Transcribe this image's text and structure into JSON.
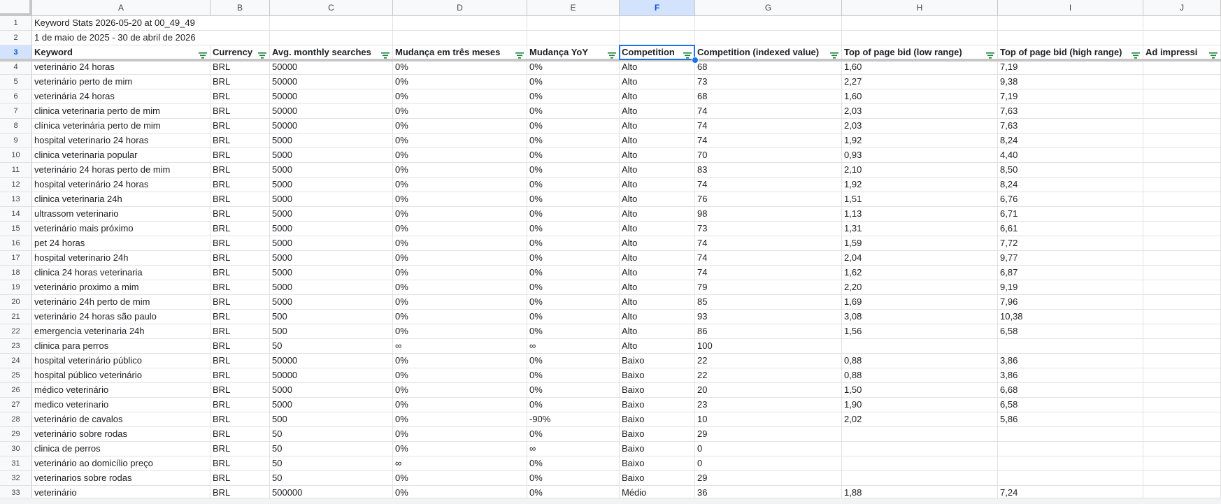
{
  "columns": [
    "A",
    "B",
    "C",
    "D",
    "E",
    "F",
    "G",
    "H",
    "I",
    "J"
  ],
  "active_column": "F",
  "active_row": 3,
  "rows": [
    {
      "num": "1",
      "cells": [
        "Keyword Stats 2026-05-20 at 00_49_49",
        "",
        "",
        "",
        "",
        "",
        "",
        "",
        "",
        ""
      ]
    },
    {
      "num": "2",
      "cells": [
        "1 de maio de 2025 - 30 de abril de 2026",
        "",
        "",
        "",
        "",
        "",
        "",
        "",
        "",
        ""
      ]
    },
    {
      "num": "3",
      "cells": [
        "Keyword",
        "Currency",
        "Avg. monthly searches",
        "Mudança em três meses",
        "Mudança YoY",
        "Competition",
        "Competition (indexed value)",
        "Top of page bid (low range)",
        "Top of page bid (high range)",
        "Ad impressi"
      ]
    },
    {
      "num": "4",
      "cells": [
        "veterinário 24 horas",
        "BRL",
        "50000",
        "0%",
        "0%",
        "Alto",
        "68",
        "1,60",
        "7,19",
        ""
      ]
    },
    {
      "num": "5",
      "cells": [
        "veterinário perto de mim",
        "BRL",
        "50000",
        "0%",
        "0%",
        "Alto",
        "73",
        "2,27",
        "9,38",
        ""
      ]
    },
    {
      "num": "6",
      "cells": [
        "veterinária 24 horas",
        "BRL",
        "50000",
        "0%",
        "0%",
        "Alto",
        "68",
        "1,60",
        "7,19",
        ""
      ]
    },
    {
      "num": "7",
      "cells": [
        "clinica veterinaria perto de mim",
        "BRL",
        "50000",
        "0%",
        "0%",
        "Alto",
        "74",
        "2,03",
        "7,63",
        ""
      ]
    },
    {
      "num": "8",
      "cells": [
        "clínica veterinária perto de mim",
        "BRL",
        "50000",
        "0%",
        "0%",
        "Alto",
        "74",
        "2,03",
        "7,63",
        ""
      ]
    },
    {
      "num": "9",
      "cells": [
        "hospital veterinario 24 horas",
        "BRL",
        "5000",
        "0%",
        "0%",
        "Alto",
        "74",
        "1,92",
        "8,24",
        ""
      ]
    },
    {
      "num": "10",
      "cells": [
        "clinica veterinaria popular",
        "BRL",
        "5000",
        "0%",
        "0%",
        "Alto",
        "70",
        "0,93",
        "4,40",
        ""
      ]
    },
    {
      "num": "11",
      "cells": [
        "veterinário 24 horas perto de mim",
        "BRL",
        "5000",
        "0%",
        "0%",
        "Alto",
        "83",
        "2,10",
        "8,50",
        ""
      ]
    },
    {
      "num": "12",
      "cells": [
        "hospital veterinário 24 horas",
        "BRL",
        "5000",
        "0%",
        "0%",
        "Alto",
        "74",
        "1,92",
        "8,24",
        ""
      ]
    },
    {
      "num": "13",
      "cells": [
        "clinica veterinaria 24h",
        "BRL",
        "5000",
        "0%",
        "0%",
        "Alto",
        "76",
        "1,51",
        "6,76",
        ""
      ]
    },
    {
      "num": "14",
      "cells": [
        "ultrassom veterinario",
        "BRL",
        "5000",
        "0%",
        "0%",
        "Alto",
        "98",
        "1,13",
        "6,71",
        ""
      ]
    },
    {
      "num": "15",
      "cells": [
        "veterinário mais próximo",
        "BRL",
        "5000",
        "0%",
        "0%",
        "Alto",
        "73",
        "1,31",
        "6,61",
        ""
      ]
    },
    {
      "num": "16",
      "cells": [
        "pet 24 horas",
        "BRL",
        "5000",
        "0%",
        "0%",
        "Alto",
        "74",
        "1,59",
        "7,72",
        ""
      ]
    },
    {
      "num": "17",
      "cells": [
        "hospital veterinario 24h",
        "BRL",
        "5000",
        "0%",
        "0%",
        "Alto",
        "74",
        "2,04",
        "9,77",
        ""
      ]
    },
    {
      "num": "18",
      "cells": [
        "clinica 24 horas veterinaria",
        "BRL",
        "5000",
        "0%",
        "0%",
        "Alto",
        "74",
        "1,62",
        "6,87",
        ""
      ]
    },
    {
      "num": "19",
      "cells": [
        "veterinário proximo a mim",
        "BRL",
        "5000",
        "0%",
        "0%",
        "Alto",
        "79",
        "2,20",
        "9,19",
        ""
      ]
    },
    {
      "num": "20",
      "cells": [
        "veterinário 24h perto de mim",
        "BRL",
        "5000",
        "0%",
        "0%",
        "Alto",
        "85",
        "1,69",
        "7,96",
        ""
      ]
    },
    {
      "num": "21",
      "cells": [
        "veterinário 24 horas são paulo",
        "BRL",
        "500",
        "0%",
        "0%",
        "Alto",
        "93",
        "3,08",
        "10,38",
        ""
      ]
    },
    {
      "num": "22",
      "cells": [
        "emergencia veterinaria 24h",
        "BRL",
        "500",
        "0%",
        "0%",
        "Alto",
        "86",
        "1,56",
        "6,58",
        ""
      ]
    },
    {
      "num": "23",
      "cells": [
        "clinica para perros",
        "BRL",
        "50",
        "∞",
        "∞",
        "Alto",
        "100",
        "",
        "",
        ""
      ]
    },
    {
      "num": "24",
      "cells": [
        "hospital veterinário público",
        "BRL",
        "50000",
        "0%",
        "0%",
        "Baixo",
        "22",
        "0,88",
        "3,86",
        ""
      ]
    },
    {
      "num": "25",
      "cells": [
        "hospital público veterinário",
        "BRL",
        "50000",
        "0%",
        "0%",
        "Baixo",
        "22",
        "0,88",
        "3,86",
        ""
      ]
    },
    {
      "num": "26",
      "cells": [
        "médico veterinário",
        "BRL",
        "5000",
        "0%",
        "0%",
        "Baixo",
        "20",
        "1,50",
        "6,68",
        ""
      ]
    },
    {
      "num": "27",
      "cells": [
        "medico veterinario",
        "BRL",
        "5000",
        "0%",
        "0%",
        "Baixo",
        "23",
        "1,90",
        "6,58",
        ""
      ]
    },
    {
      "num": "28",
      "cells": [
        "veterinário de cavalos",
        "BRL",
        "500",
        "0%",
        "-90%",
        "Baixo",
        "10",
        "2,02",
        "5,86",
        ""
      ]
    },
    {
      "num": "29",
      "cells": [
        "veterinário sobre rodas",
        "BRL",
        "50",
        "0%",
        "0%",
        "Baixo",
        "29",
        "",
        "",
        ""
      ]
    },
    {
      "num": "30",
      "cells": [
        "clinica de perros",
        "BRL",
        "50",
        "0%",
        "∞",
        "Baixo",
        "0",
        "",
        "",
        ""
      ]
    },
    {
      "num": "31",
      "cells": [
        "veterinário ao domicílio preço",
        "BRL",
        "50",
        "∞",
        "0%",
        "Baixo",
        "0",
        "",
        "",
        ""
      ]
    },
    {
      "num": "32",
      "cells": [
        "veterinarios sobre rodas",
        "BRL",
        "50",
        "0%",
        "0%",
        "Baixo",
        "29",
        "",
        "",
        ""
      ]
    },
    {
      "num": "33",
      "cells": [
        "veterinário",
        "BRL",
        "500000",
        "0%",
        "0%",
        "Médio",
        "36",
        "1,88",
        "7,24",
        ""
      ]
    }
  ],
  "colors": {
    "filter_icon": "#188038",
    "selection": "#1a73e8",
    "header_bg": "#f8f9fa",
    "active_header_bg": "#d3e3fd"
  },
  "icons": {
    "filter": "filter-icon"
  }
}
